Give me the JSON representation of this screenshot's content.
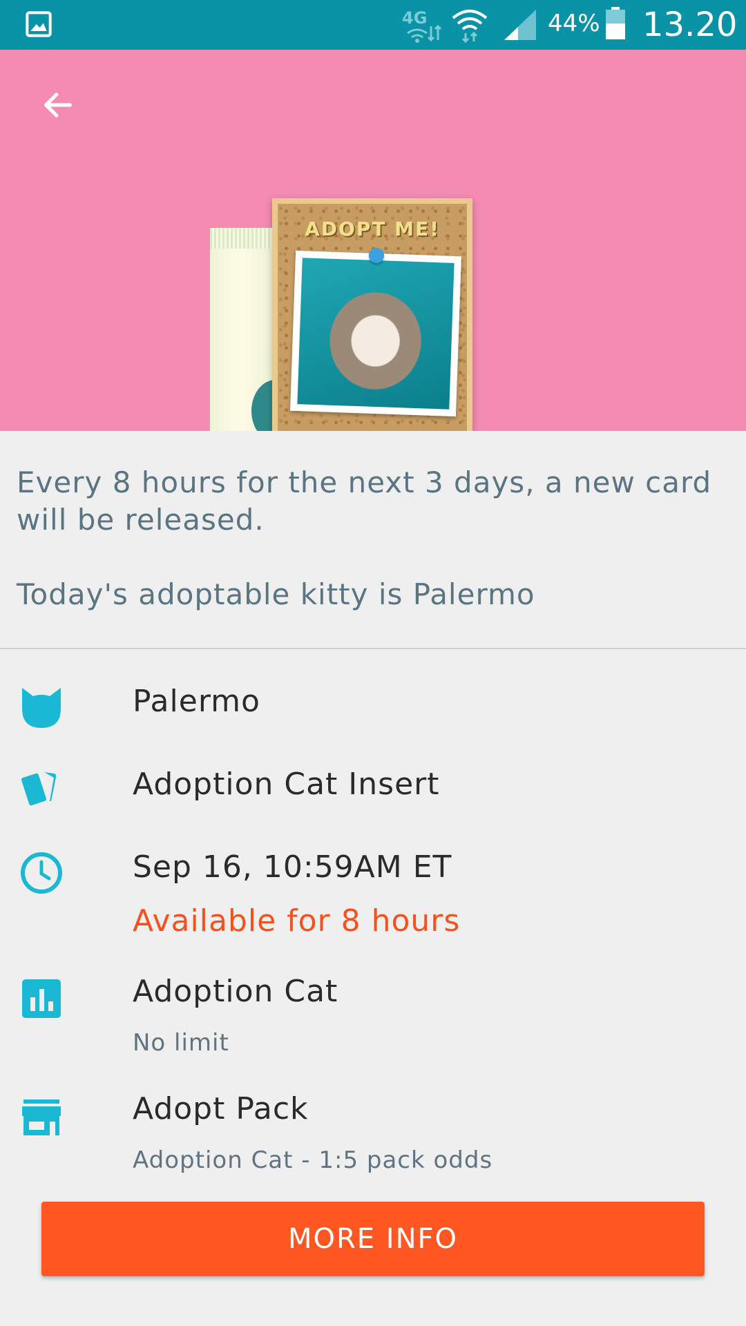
{
  "status_bar": {
    "network_label": "4G",
    "battery_percent": "44%",
    "time": "13.20",
    "icons": [
      "gallery-icon",
      "network-4g-icon",
      "wifi-icon",
      "signal-icon",
      "battery-icon"
    ]
  },
  "hero": {
    "card_heading": "ADOPT ME!",
    "background_color": "#f48bb0"
  },
  "description": {
    "paragraph_1": "Every 8 hours for the next 3 days, a new card will be released.",
    "paragraph_2": "Today's adoptable kitty is Palermo"
  },
  "details": {
    "name": "Palermo",
    "card_type": "Adoption Cat Insert",
    "release_time": "Sep 16, 10:59AM ET",
    "availability": "Available for 8 hours",
    "series": "Adoption Cat",
    "limit": "No limit",
    "pack": "Adopt Pack",
    "pack_odds": "Adoption Cat - 1:5 pack odds"
  },
  "button": {
    "label": "MORE INFO"
  },
  "colors": {
    "status_bar": "#0a93a6",
    "accent_icon": "#1ab8d2",
    "button": "#ff5722",
    "warning_text": "#f4511e"
  }
}
